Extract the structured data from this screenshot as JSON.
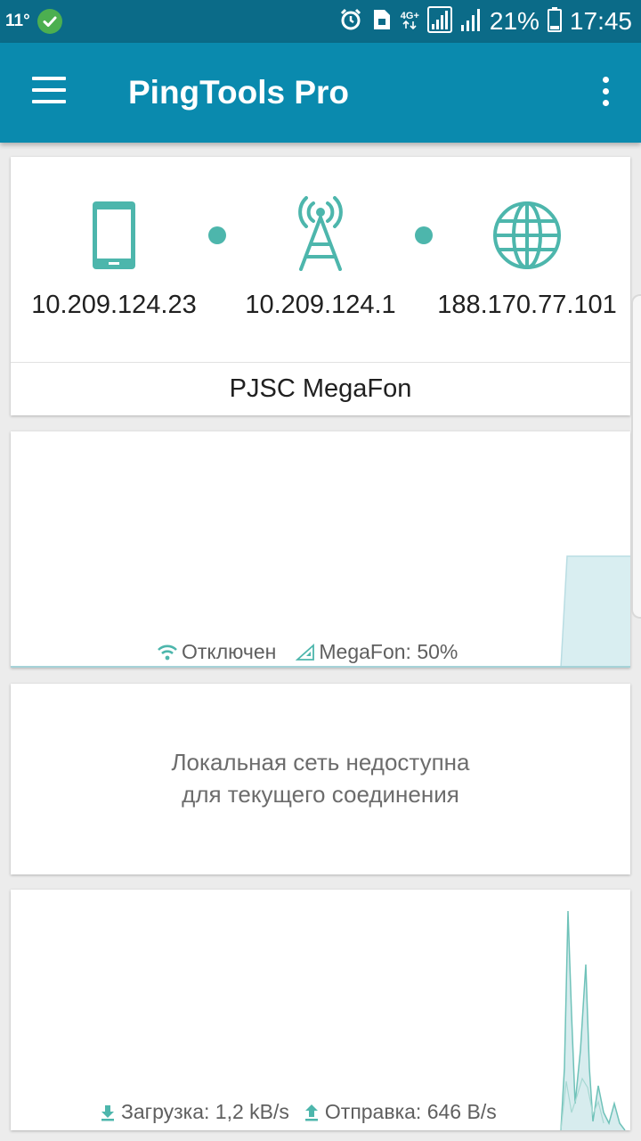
{
  "status_bar": {
    "temperature": "11°",
    "network_type": "4G+",
    "battery_percent": "21%",
    "time": "17:45"
  },
  "app_bar": {
    "title": "PingTools Pro",
    "menu_icon": "hamburger-menu-icon",
    "overflow_icon": "more-vert-icon"
  },
  "route": {
    "device": {
      "icon": "smartphone-icon",
      "ip": "10.209.124.23"
    },
    "gateway": {
      "icon": "cell-tower-icon",
      "ip": "10.209.124.1"
    },
    "external": {
      "icon": "globe-icon",
      "ip": "188.170.77.101"
    },
    "provider": "PJSC MegaFon"
  },
  "signal_card": {
    "wifi_status": "Отключен",
    "cell_status": "MegaFon: 50%",
    "accent_color": "#4db6ac",
    "fill_color": "#d9eef1"
  },
  "lan_card": {
    "line1": "Локальная сеть недоступна",
    "line2": "для текущего соединения"
  },
  "traffic_card": {
    "download": "Загрузка: 1,2 kB/s",
    "upload": "Отправка: 646 B/s"
  }
}
